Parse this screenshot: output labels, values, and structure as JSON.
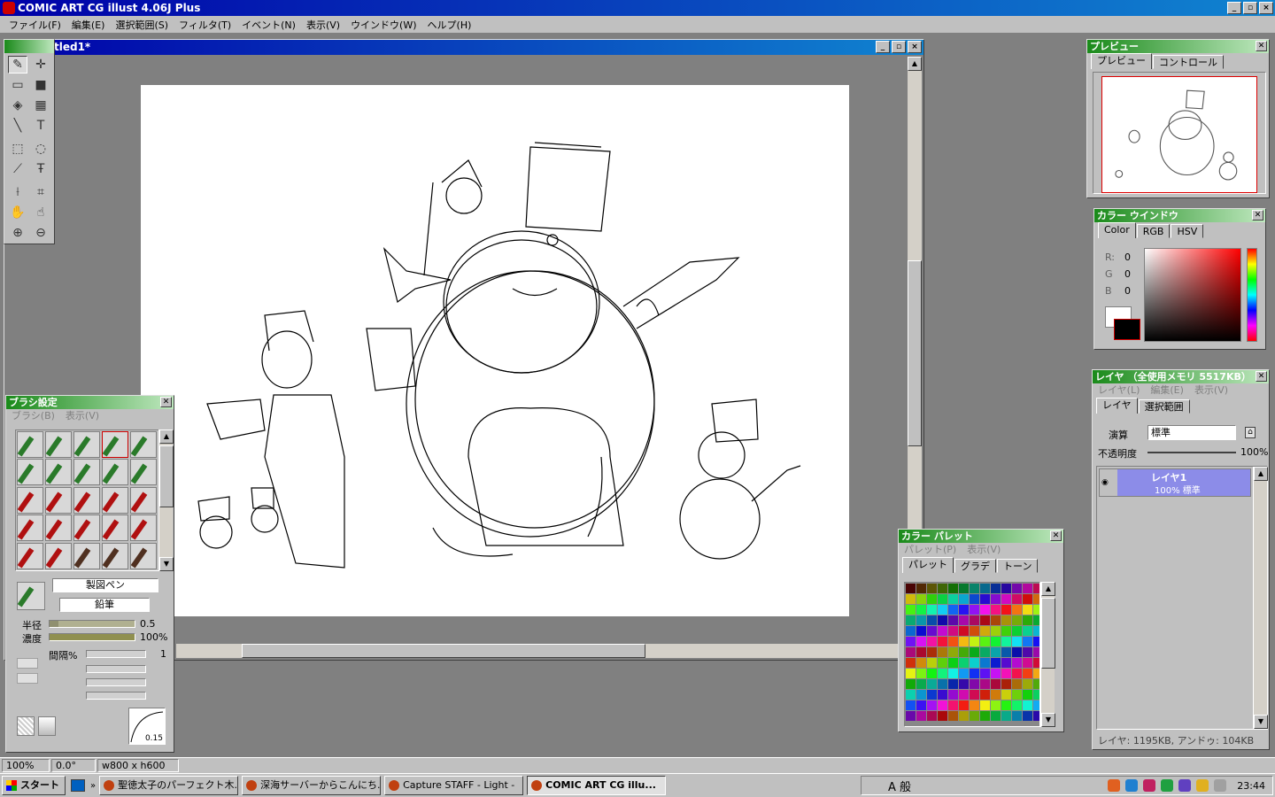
{
  "app": {
    "title": "COMIC ART CG illust 4.06J Plus",
    "window_buttons": [
      "_",
      "▫",
      "×"
    ]
  },
  "menu": [
    "ファイル(F)",
    "編集(E)",
    "選択範囲(S)",
    "フィルタ(T)",
    "イベント(N)",
    "表示(V)",
    "ウインドウ(W)",
    "ヘルプ(H)"
  ],
  "document": {
    "title": "tled1*"
  },
  "preview": {
    "title": "プレビュー",
    "tabs": [
      "プレビュー",
      "コントロール"
    ]
  },
  "color_window": {
    "title": "カラー ウインドウ",
    "tabs": [
      "Color",
      "RGB",
      "HSV"
    ],
    "r_label": "R:",
    "g_label": "G",
    "b_label": "B",
    "r": "0",
    "g": "0",
    "b": "0",
    "fg": "#000000",
    "bg": "#ffffff"
  },
  "layer": {
    "title": "レイヤ （全使用メモリ 5517KB）",
    "menu": [
      "レイヤ(L)",
      "編集(E)",
      "表示(V)"
    ],
    "tabs": [
      "レイヤ",
      "選択範囲"
    ],
    "blend_label": "演算",
    "blend_value": "標準",
    "opacity_label": "不透明度",
    "opacity_value": "100%",
    "opacity": 1.0,
    "items": [
      {
        "name": "レイヤ1",
        "info": "100%  標準"
      }
    ],
    "status": "レイヤ: 1195KB, アンドゥ: 104KB"
  },
  "palette": {
    "title": "カラー パレット",
    "menu": [
      "パレット(P)",
      "表示(V)"
    ],
    "tabs": [
      "パレット",
      "グラデ",
      "トーン"
    ]
  },
  "brush": {
    "title": "ブラシ設定",
    "menu": [
      "ブラシ(B)",
      "表示(V)"
    ],
    "name1": "製図ペン",
    "name2": "鉛筆",
    "radius_label": "半径",
    "radius_value": "0.5",
    "radius": 0.1,
    "density_label": "濃度",
    "density_value": "100%",
    "density": 1.0,
    "interval_label": "間隔%",
    "interval_value": "1",
    "curve_value": "0.15"
  },
  "status": {
    "zoom": "100%",
    "angle": "0.0°",
    "size": "w800 x h600"
  },
  "taskbar": {
    "start": "スタート",
    "tasks": [
      "聖徳太子のパーフェクト木...",
      "深海サーバーからこんにち...",
      "Capture STAFF - Light -",
      "COMIC ART CG illu..."
    ],
    "clock": "23:44",
    "ime": "A 般"
  }
}
